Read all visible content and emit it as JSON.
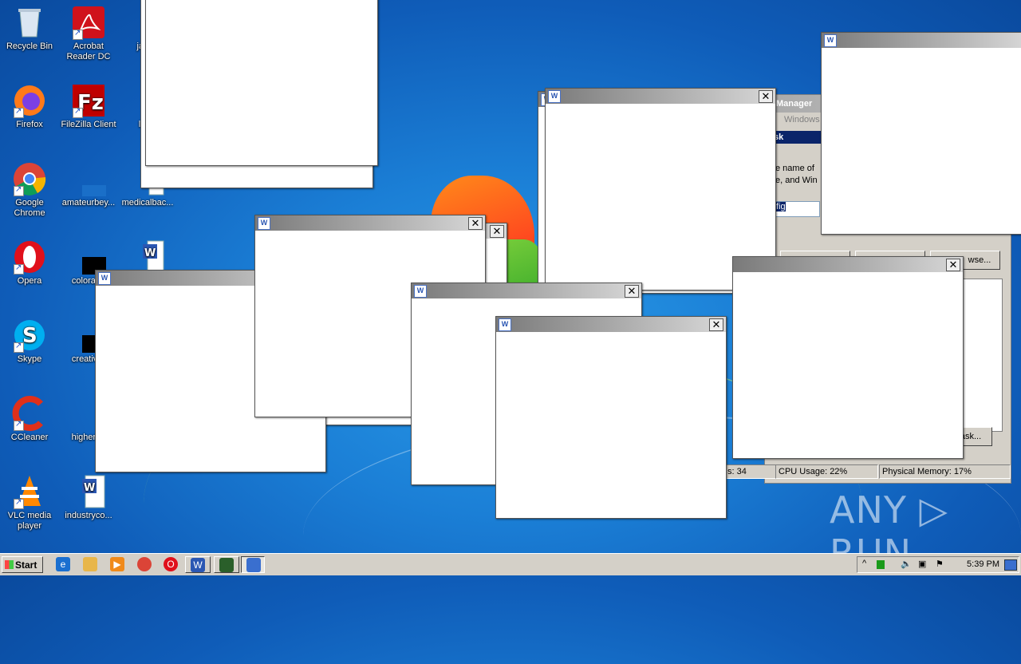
{
  "desktop": {
    "icons": [
      {
        "label": "Recycle Bin",
        "icon": "recycle-bin-icon"
      },
      {
        "label": "Acrobat Reader DC",
        "icon": "acrobat-icon"
      },
      {
        "label": "janua",
        "icon": "word-doc-icon"
      },
      {
        "label": "Firefox",
        "icon": "firefox-icon"
      },
      {
        "label": "FileZilla Client",
        "icon": "filezilla-icon"
      },
      {
        "label": "lowe",
        "icon": "word-doc-icon"
      },
      {
        "label": "Google Chrome",
        "icon": "chrome-icon"
      },
      {
        "label": "amateurbey...",
        "icon": "blank-file-icon"
      },
      {
        "label": "medicalbac...",
        "icon": "word-doc-icon"
      },
      {
        "label": "Opera",
        "icon": "opera-icon"
      },
      {
        "label": "colorado",
        "icon": "black-file-icon"
      },
      {
        "label": "Skype",
        "icon": "skype-icon"
      },
      {
        "label": "creativer",
        "icon": "black-file-icon"
      },
      {
        "label": "CCleaner",
        "icon": "ccleaner-icon"
      },
      {
        "label": "higherho",
        "icon": "blank-file-icon"
      },
      {
        "label": "VLC media player",
        "icon": "vlc-icon"
      },
      {
        "label": "industryco...",
        "icon": "word-doc-icon"
      }
    ]
  },
  "windows": {
    "word_icon_text": "W",
    "close_label": "✕"
  },
  "task_manager": {
    "title_fragment": "Manager",
    "menu_fragment": "Windows",
    "run_title_fragment": "sk",
    "run_text": "e name of e, and Win",
    "input_fragment": "fig",
    "browse_label": "wse...",
    "newtask_label": "ask...",
    "status_processes": "s: 34",
    "status_cpu": "CPU Usage: 22%",
    "status_memory": "Physical Memory: 17%"
  },
  "taskbar": {
    "start_label": "Start",
    "clock": "5:39 PM"
  },
  "watermark": "ANY ▷ RUN"
}
